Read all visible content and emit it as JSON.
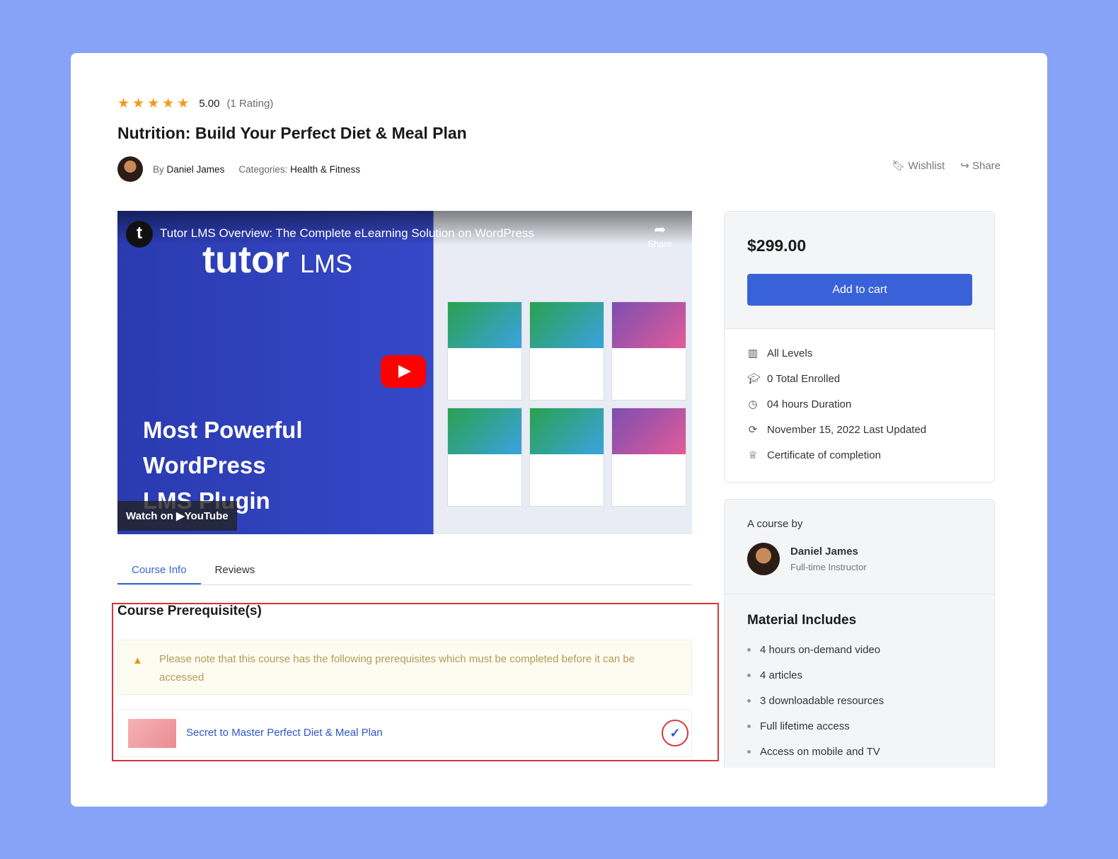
{
  "course": {
    "rating": "5.00",
    "rating_count": "(1 Rating)",
    "stars": 5,
    "title": "Nutrition: Build Your Perfect Diet & Meal Plan",
    "by_label": "By",
    "author": "Daniel James",
    "categories_label": "Categories:",
    "category": "Health & Fitness"
  },
  "actions": {
    "wishlist": "Wishlist",
    "share": "Share"
  },
  "video": {
    "title": "Tutor LMS Overview: The Complete eLearning Solution on WordPress",
    "share": "Share",
    "logo_text": "tutor",
    "logo_suffix": "LMS",
    "headline": [
      "Most Powerful",
      "WordPress",
      "LMS Plugin"
    ],
    "watch_on": "Watch on",
    "youtube": "YouTube"
  },
  "tabs": [
    {
      "label": "Course Info",
      "active": true
    },
    {
      "label": "Reviews",
      "active": false
    }
  ],
  "prerequisites": {
    "title": "Course Prerequisite(s)",
    "notice": "Please note that this course has the following prerequisites which must be completed before it can be accessed",
    "items": [
      {
        "title": "Secret to Master Perfect Diet & Meal Plan",
        "completed": true
      }
    ]
  },
  "sidebar": {
    "price": "$299.00",
    "add_to_cart": "Add to cart",
    "info": [
      {
        "icon": "level-bars-icon",
        "text": "All Levels"
      },
      {
        "icon": "graduation-cap-icon",
        "text": "0 Total Enrolled"
      },
      {
        "icon": "clock-icon",
        "text": "04 hours  Duration"
      },
      {
        "icon": "refresh-icon",
        "text": "November 15, 2022 Last Updated"
      },
      {
        "icon": "certificate-icon",
        "text": "Certificate of completion"
      }
    ],
    "course_by_label": "A course by",
    "instructor_name": "Daniel James",
    "instructor_role": "Full-time Instructor",
    "materials_title": "Material Includes",
    "materials": [
      "4 hours on-demand video",
      "4 articles",
      "3 downloadable resources",
      "Full lifetime access",
      "Access on mobile and TV"
    ]
  },
  "colors": {
    "accent": "#3a62d8",
    "star": "#f29a1b",
    "highlight": "#d7353b",
    "background": "#86a3f7"
  }
}
